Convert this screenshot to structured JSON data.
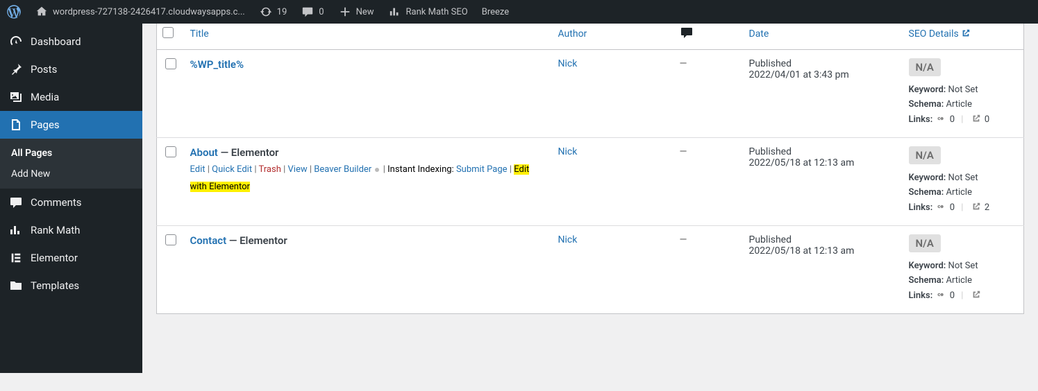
{
  "toolbar": {
    "site_label": "wordpress-727138-2426417.cloudwaysapps.c...",
    "update_count": "19",
    "comment_count": "0",
    "new_label": "New",
    "rankmath_label": "Rank Math SEO",
    "breeze_label": "Breeze"
  },
  "sidebar": {
    "dashboard": "Dashboard",
    "posts": "Posts",
    "media": "Media",
    "pages": "Pages",
    "all_pages": "All Pages",
    "add_new": "Add New",
    "comments": "Comments",
    "rank_math": "Rank Math",
    "elementor": "Elementor",
    "templates": "Templates"
  },
  "table": {
    "headers": {
      "title": "Title",
      "author": "Author",
      "date": "Date",
      "seo": "SEO Details"
    },
    "rows": [
      {
        "title": "%WP_title%",
        "state": "",
        "author": "Nick",
        "comments": "—",
        "date_status": "Published",
        "date": "2022/04/01 at 3:43 pm",
        "seo": {
          "badge": "N/A",
          "keyword": "Not Set",
          "schema": "Article",
          "int": "0",
          "ext": "0"
        }
      },
      {
        "title": "About",
        "state": " — Elementor",
        "author": "Nick",
        "comments": "—",
        "date_status": "Published",
        "date": "2022/05/18 at 12:13 am",
        "seo": {
          "badge": "N/A",
          "keyword": "Not Set",
          "schema": "Article",
          "int": "0",
          "ext": "2"
        },
        "actions": {
          "edit": "Edit",
          "quick": "Quick Edit",
          "trash": "Trash",
          "view": "View",
          "bb": "Beaver Builder",
          "ii": "Instant Indexing:",
          "submit": "Submit Page",
          "ewe": "Edit with Elementor"
        }
      },
      {
        "title": "Contact",
        "state": " — Elementor",
        "author": "Nick",
        "comments": "—",
        "date_status": "Published",
        "date": "2022/05/18 at 12:13 am",
        "seo": {
          "badge": "N/A",
          "keyword": "Not Set",
          "schema": "Article",
          "int": "0",
          "ext": ""
        }
      }
    ]
  },
  "seo_labels": {
    "keyword": "Keyword:",
    "schema": "Schema:",
    "links": "Links:"
  }
}
